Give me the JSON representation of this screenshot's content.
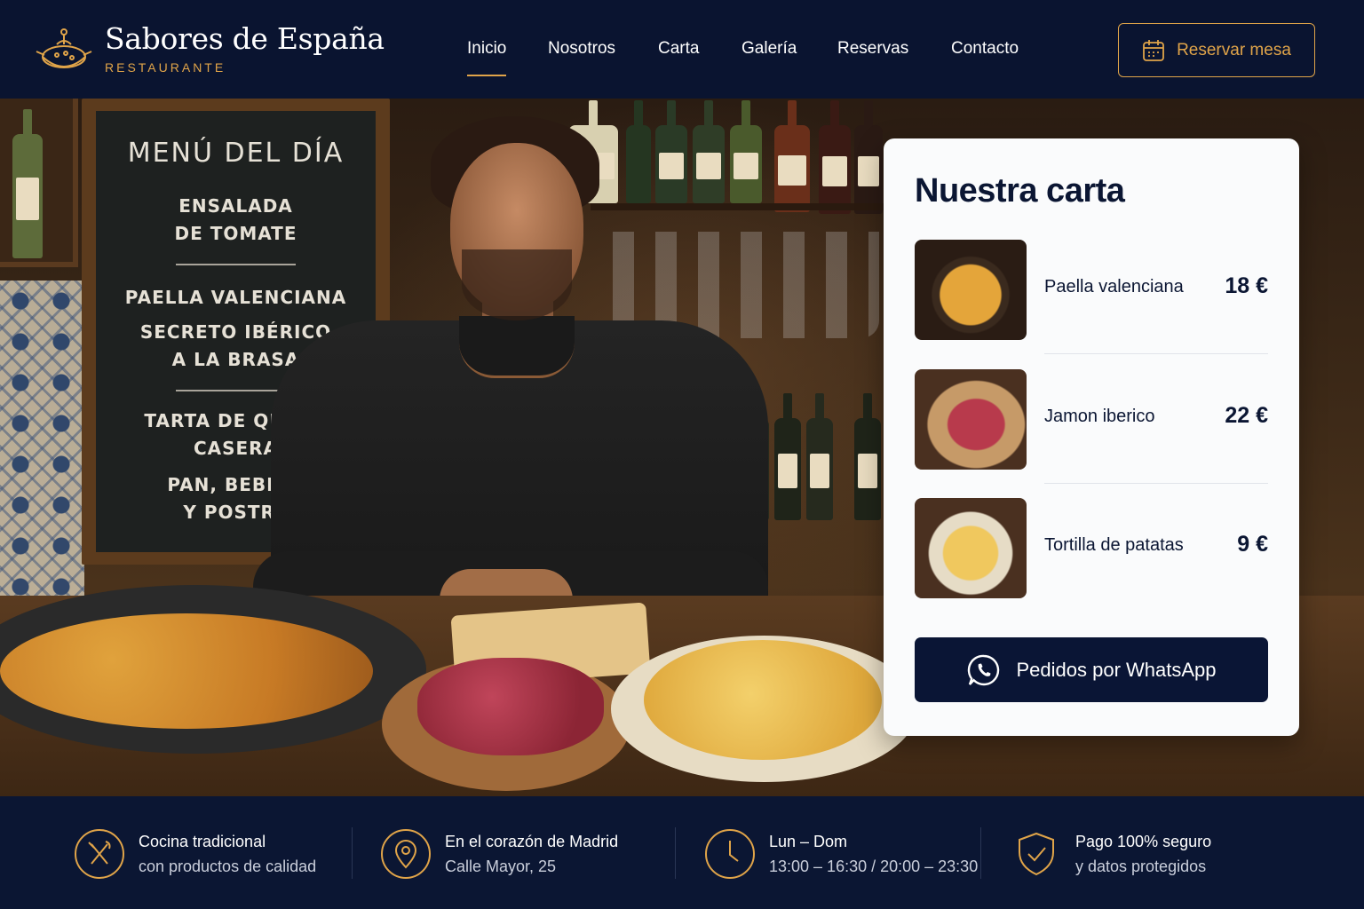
{
  "brand": {
    "name": "Sabores de España",
    "tagline": "RESTAURANTE"
  },
  "nav": {
    "items": [
      {
        "label": "Inicio",
        "active": true
      },
      {
        "label": "Nosotros",
        "active": false
      },
      {
        "label": "Carta",
        "active": false
      },
      {
        "label": "Galería",
        "active": false
      },
      {
        "label": "Reservas",
        "active": false
      },
      {
        "label": "Contacto",
        "active": false
      }
    ],
    "reserve_label": "Reservar mesa"
  },
  "hero": {
    "chalkboard": {
      "title": "MENÚ DEL DÍA",
      "lines": [
        "ENSALADA",
        "DE TOMATE",
        "PAELLA VALENCIANA",
        "SECRETO IBÉRICO",
        "A LA BRASA",
        "TARTA DE QUESO",
        "CASERA",
        "PAN, BEBIDA",
        "Y POSTRE"
      ]
    }
  },
  "menu_card": {
    "title": "Nuestra carta",
    "items": [
      {
        "name": "Paella valenciana",
        "price": "18 €",
        "thumb": "paella-photo"
      },
      {
        "name": "Jamon iberico",
        "price": "22 €",
        "thumb": "jamon-photo"
      },
      {
        "name": "Tortilla de patatas",
        "price": "9 €",
        "thumb": "tortilla-photo"
      }
    ],
    "whatsapp_label": "Pedidos por WhatsApp"
  },
  "features": [
    {
      "icon": "utensils-icon",
      "line1": "Cocina tradicional",
      "line2": "con productos de calidad"
    },
    {
      "icon": "map-pin-icon",
      "line1": "En el corazón de Madrid",
      "line2": "Calle Mayor, 25"
    },
    {
      "icon": "clock-icon",
      "line1": "Lun – Dom",
      "line2": "13:00 – 16:30 / 20:00 – 23:30"
    },
    {
      "icon": "shield-check-icon",
      "line1": "Pago 100% seguro",
      "line2": "y datos protegidos"
    }
  ],
  "colors": {
    "navy": "#0a1430",
    "accent": "#e0a449",
    "card": "#fafbfc"
  }
}
